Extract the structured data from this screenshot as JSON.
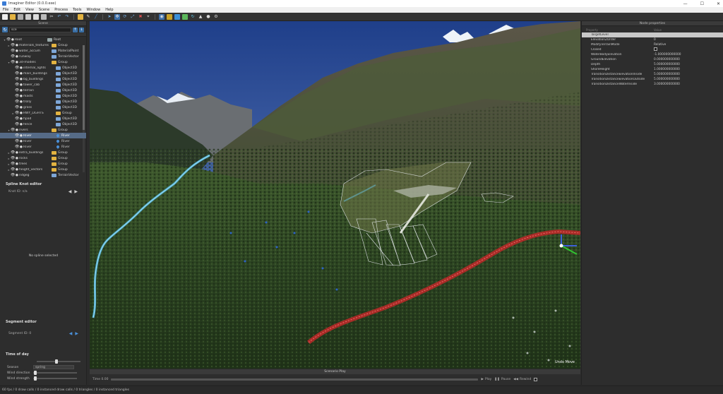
{
  "window": {
    "title": "Imaginer Editor (0.0.0.exe)",
    "minimize": "—",
    "maximize": "☐",
    "close": "✕"
  },
  "menu": [
    "File",
    "Edit",
    "View",
    "Scene",
    "Process",
    "Tools",
    "Window",
    "Help"
  ],
  "scene_panel": {
    "header": "Scene",
    "search_value": "sce",
    "tree": [
      {
        "indent": 0,
        "arrow": "▾",
        "name": "Root",
        "type": "Root",
        "icon": "root"
      },
      {
        "indent": 1,
        "arrow": "▸",
        "name": "materials_textures",
        "type": "Group",
        "icon": "folder"
      },
      {
        "indent": 1,
        "arrow": "",
        "name": "water_accum",
        "type": "MaterialPaint",
        "icon": "obj"
      },
      {
        "indent": 1,
        "arrow": "",
        "name": "runway",
        "type": "TerrainVector",
        "icon": "obj"
      },
      {
        "indent": 1,
        "arrow": "▾",
        "name": "3d-models",
        "type": "Group",
        "icon": "folder"
      },
      {
        "indent": 2,
        "arrow": "",
        "name": "internal_lights",
        "type": "Object3D",
        "icon": "obj"
      },
      {
        "indent": 2,
        "arrow": "",
        "name": "main_buildings",
        "type": "Object3D",
        "icon": "obj"
      },
      {
        "indent": 2,
        "arrow": "",
        "name": "bg_buildings",
        "type": "Object3D",
        "icon": "obj"
      },
      {
        "indent": 2,
        "arrow": "",
        "name": "tower_cab",
        "type": "Object3D",
        "icon": "obj"
      },
      {
        "indent": 2,
        "arrow": "",
        "name": "terrain",
        "type": "Object3D",
        "icon": "obj"
      },
      {
        "indent": 2,
        "arrow": "",
        "name": "masts",
        "type": "Object3D",
        "icon": "obj"
      },
      {
        "indent": 2,
        "arrow": "",
        "name": "trolly",
        "type": "Object3D",
        "icon": "obj"
      },
      {
        "indent": 2,
        "arrow": "",
        "name": "grass",
        "type": "Object3D",
        "icon": "obj"
      },
      {
        "indent": 2,
        "arrow": "▸",
        "name": "RWY_LIGHTS",
        "type": "Group",
        "icon": "folder"
      },
      {
        "indent": 2,
        "arrow": "",
        "name": "hpad",
        "type": "Object3D",
        "icon": "obj"
      },
      {
        "indent": 2,
        "arrow": "",
        "name": "fence",
        "type": "Object3D",
        "icon": "obj"
      },
      {
        "indent": 1,
        "arrow": "▾",
        "name": "rivers",
        "type": "Group",
        "icon": "folder"
      },
      {
        "indent": 2,
        "arrow": "",
        "name": "River",
        "type": "River",
        "icon": "drop",
        "selected": true
      },
      {
        "indent": 2,
        "arrow": "",
        "name": "River",
        "type": "River",
        "icon": "drop"
      },
      {
        "indent": 2,
        "arrow": "",
        "name": "River",
        "type": "River",
        "icon": "drop"
      },
      {
        "indent": 1,
        "arrow": "▸",
        "name": "extra_buildings",
        "type": "Group",
        "icon": "folder"
      },
      {
        "indent": 1,
        "arrow": "▸",
        "name": "rocks",
        "type": "Group",
        "icon": "folder"
      },
      {
        "indent": 1,
        "arrow": "▸",
        "name": "trees",
        "type": "Group",
        "icon": "folder"
      },
      {
        "indent": 1,
        "arrow": "▸",
        "name": "height_vectors",
        "type": "Group",
        "icon": "folder"
      },
      {
        "indent": 1,
        "arrow": "",
        "name": "ridgeg",
        "type": "TerrainVector",
        "icon": "obj"
      }
    ]
  },
  "spline_editor": {
    "title": "Spline Knot editor",
    "knot_id": "Knot ID: n/a",
    "empty": "No spline selected"
  },
  "segment_editor": {
    "title": "Segment editor",
    "segment_id": "Segment ID: 0"
  },
  "time_of_day": {
    "title": "Time of day",
    "time_slider": 0.45,
    "season_label": "Season",
    "season_value": "spring",
    "wind_direction_label": "Wind direction",
    "wind_direction": 0.02,
    "wind_strength_label": "Wind strength",
    "wind_strength": 0.02
  },
  "viewport": {
    "undo_text": "Undo Move"
  },
  "scenario": {
    "header": "Scenario Play",
    "time": "Time 0.00",
    "play": "Play",
    "pause": "Pause",
    "rewind": "Rewind"
  },
  "node_properties": {
    "header": "Node properties",
    "col_property": "Property",
    "col_value": "Value",
    "rows": [
      {
        "k": "TargetLevel",
        "v": "",
        "hl": true
      },
      {
        "k": "ElevationZOrder",
        "v": "0"
      },
      {
        "k": "ModifyTerrainMode",
        "v": "Relative"
      },
      {
        "k": "Closed",
        "v": "",
        "checkbox": true
      },
      {
        "k": "WaterBodyElevation",
        "v": "-1.000000000000"
      },
      {
        "k": "GroundElevation",
        "v": "0.000000000000"
      },
      {
        "k": "Depth",
        "v": "5.000000000000"
      },
      {
        "k": "ShoreHeight",
        "v": "1.000000000000"
      },
      {
        "k": "TransitionDistanceElevationInside",
        "v": "5.000000000000"
      },
      {
        "k": "TransitionDistanceElevationOutside",
        "v": "5.000000000000"
      },
      {
        "k": "TransitionDistanceWaterInside",
        "v": "3.000000000000"
      }
    ]
  },
  "status": "60 fps / 0 draw calls / 0 instanced draw calls / 0 triangles / 0 instanced triangles"
}
